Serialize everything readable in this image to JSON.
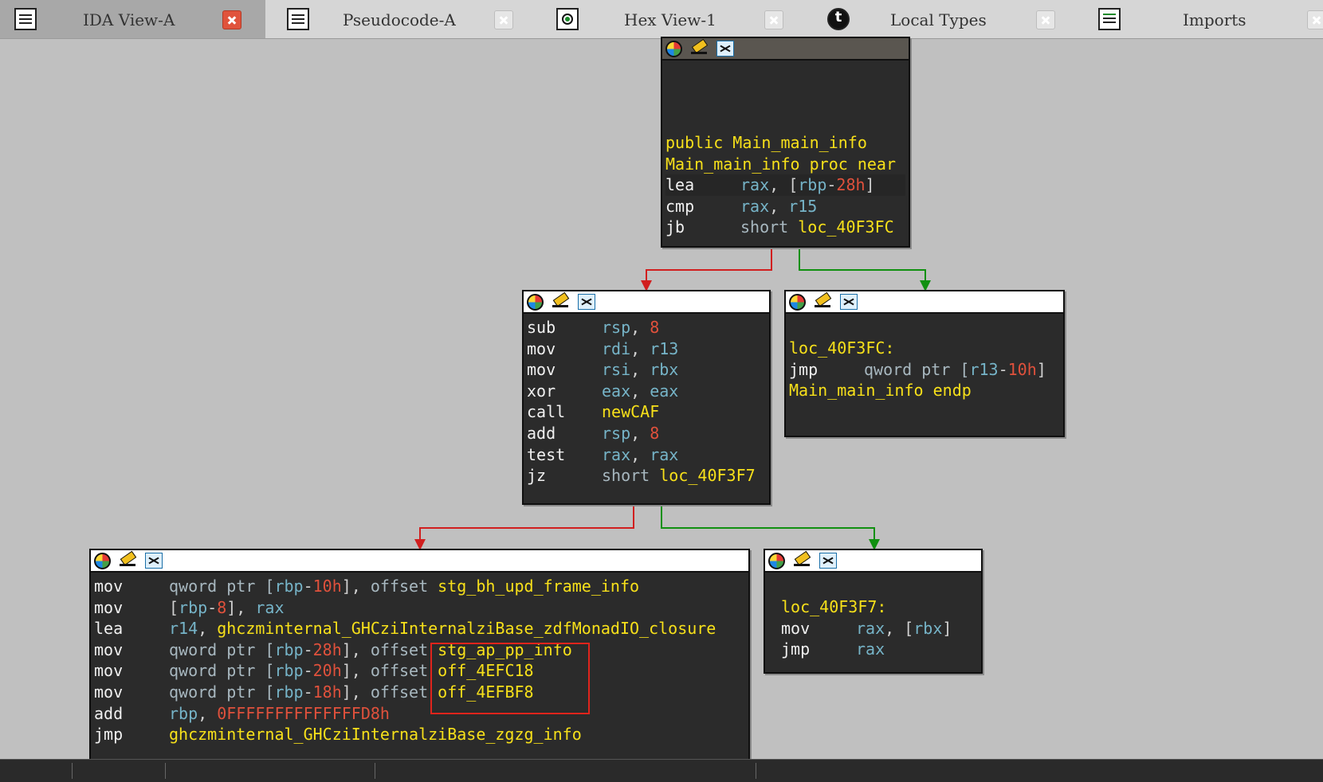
{
  "tabs": [
    {
      "label": "IDA View-A",
      "icon": "list-icon",
      "active": true
    },
    {
      "label": "Pseudocode-A",
      "icon": "list-icon",
      "active": false
    },
    {
      "label": "Hex View-1",
      "icon": "hex-view-icon",
      "active": false
    },
    {
      "label": "Local Types",
      "icon": "local-types-icon",
      "active": false
    },
    {
      "label": "Imports",
      "icon": "imports-icon",
      "active": false
    }
  ],
  "node_entry": {
    "lines": [
      [
        "public",
        "Main_main_info"
      ],
      [
        "Main_main_info",
        "proc",
        "near"
      ],
      [
        "lea",
        "rax",
        ", [",
        "rbp",
        "-",
        "28h",
        "]"
      ],
      [
        "cmp",
        "rax",
        ", ",
        "r15"
      ],
      [
        "jb",
        "short",
        "loc_40F3FC"
      ]
    ]
  },
  "node_newcaf": {
    "lines": [
      [
        "sub",
        "rsp",
        ", ",
        "8"
      ],
      [
        "mov",
        "rdi",
        ", ",
        "r13"
      ],
      [
        "mov",
        "rsi",
        ", ",
        "rbx"
      ],
      [
        "xor",
        "eax",
        ", ",
        "eax"
      ],
      [
        "call",
        "newCAF"
      ],
      [
        "add",
        "rsp",
        ", ",
        "8"
      ],
      [
        "test",
        "rax",
        ", ",
        "rax"
      ],
      [
        "jz",
        "short",
        "loc_40F3F7"
      ]
    ]
  },
  "node_40f3fc": {
    "lines": [
      [
        "loc_40F3FC:"
      ],
      [
        "jmp",
        "qword ptr [",
        "r13",
        "-",
        "10h",
        "]"
      ],
      [
        "Main_main_info",
        "endp"
      ]
    ]
  },
  "node_main": {
    "lines": [
      [
        "mov",
        "qword ptr [",
        "rbp",
        "-",
        "10h",
        "], ",
        "offset",
        "stg_bh_upd_frame_info"
      ],
      [
        "mov",
        "[",
        "rbp",
        "-",
        "8",
        "], ",
        "rax"
      ],
      [
        "lea",
        "r14",
        ", ",
        "ghczminternal_GHCziInternalziBase_zdfMonadIO_closure"
      ],
      [
        "mov",
        "qword ptr [",
        "rbp",
        "-",
        "28h",
        "], ",
        "offset",
        "stg_ap_pp_info"
      ],
      [
        "mov",
        "qword ptr [",
        "rbp",
        "-",
        "20h",
        "], ",
        "offset",
        "off_4EFC18"
      ],
      [
        "mov",
        "qword ptr [",
        "rbp",
        "-",
        "18h",
        "], ",
        "offset",
        "off_4EFBF8"
      ],
      [
        "add",
        "rbp",
        ", ",
        "0FFFFFFFFFFFFFFD8h"
      ],
      [
        "jmp",
        "ghczminternal_GHCziInternalziBase_zgzg_info"
      ]
    ]
  },
  "node_40f3f7": {
    "lines": [
      [
        "loc_40F3F7:"
      ],
      [
        "mov",
        "rax",
        ", [",
        "rbx",
        "]"
      ],
      [
        "jmp",
        "rax"
      ]
    ]
  },
  "colors": {
    "node_bg": "#2b2b2b",
    "mnemonic": "#f0f0f0",
    "label": "#f7e01a",
    "register": "#76b4c8",
    "number": "#e0513c",
    "edge_false": "#d11f1f",
    "edge_true": "#109010",
    "highlight_box": "#e0241c"
  }
}
